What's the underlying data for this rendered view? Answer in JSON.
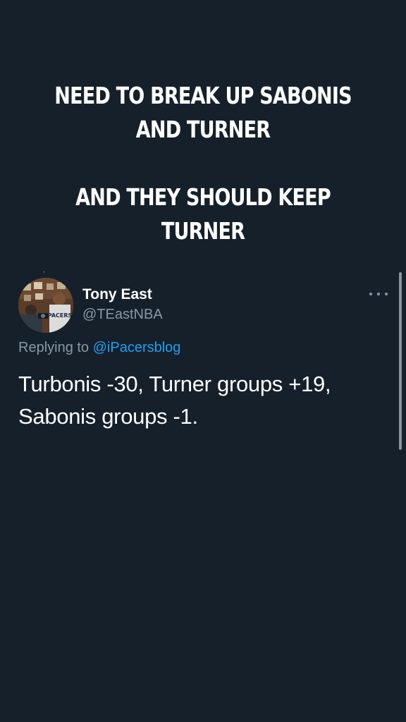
{
  "headline": {
    "line1": "NEED TO BREAK UP SABONIS",
    "line2": "AND TURNER",
    "line3": "AND THEY SHOULD KEEP",
    "line4": "TURNER"
  },
  "tweet": {
    "display_name": "Tony East",
    "handle": "@TEastNBA",
    "replying_prefix": "Replying to",
    "replying_to": "@iPacersblog",
    "text_line1": "Turbonis -30, Turner groups +19,",
    "text_line2": "Sabonis groups -1.",
    "avatar_text": "PACERS",
    "more_icon": "more-horizontal-icon"
  },
  "colors": {
    "background": "#16202b",
    "text": "#ffffff",
    "secondary": "#8899a6",
    "link": "#1da1f2"
  }
}
